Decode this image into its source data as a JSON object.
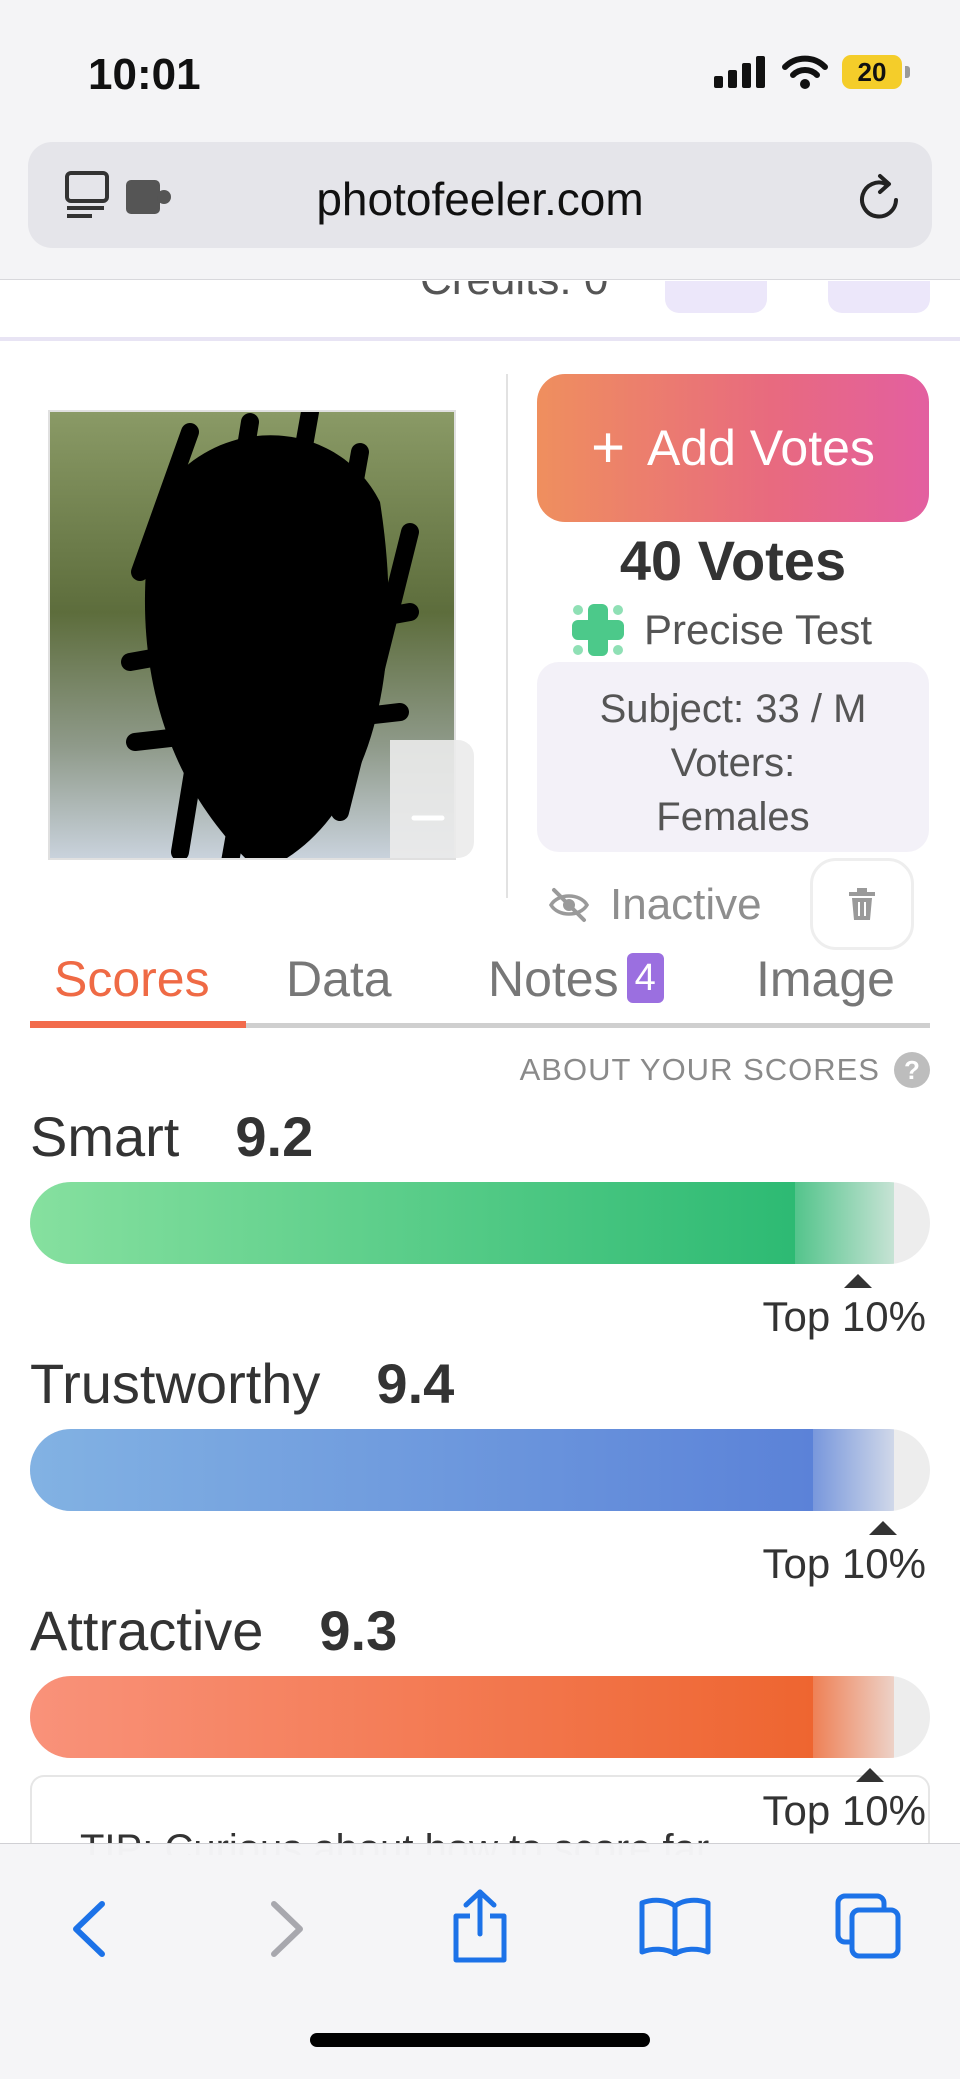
{
  "status_bar": {
    "time": "10:01",
    "battery": "20"
  },
  "browser": {
    "url": "photofeeler.com"
  },
  "header_peek": {
    "credits_text": "Credits: 0"
  },
  "photo": {
    "toggle_icon": "minus-icon"
  },
  "actions": {
    "add_votes_label": "Add Votes",
    "votes_count": "40 Votes",
    "test_type": "Precise Test"
  },
  "subject": {
    "line1": "Subject: 33 / M",
    "line2": "Voters:",
    "line3": "Females"
  },
  "status": {
    "inactive_label": "Inactive"
  },
  "tabs": [
    {
      "label": "Scores",
      "active": true
    },
    {
      "label": "Data",
      "active": false
    },
    {
      "label": "Notes",
      "badge": "4",
      "active": false
    },
    {
      "label": "Image",
      "active": false
    }
  ],
  "about_scores": "ABOUT YOUR SCORES",
  "scores": [
    {
      "label": "Smart",
      "value": "9.2",
      "percentile": "Top 10%",
      "fill_fraction": 0.85,
      "color_start": "#86e09f",
      "color_end": "#2dba73"
    },
    {
      "label": "Trustworthy",
      "value": "9.4",
      "percentile": "Top 10%",
      "fill_fraction": 0.87,
      "color_start": "#82b2e3",
      "color_end": "#5b82d8"
    },
    {
      "label": "Attractive",
      "value": "9.3",
      "percentile": "Top 10%",
      "fill_fraction": 0.87,
      "color_start": "#f9927a",
      "color_end": "#ee6530"
    }
  ],
  "tip": {
    "text": "TIP: Curious about how to score far..."
  },
  "colors": {
    "accent": "#f26b4c",
    "badge": "#9b6fe0",
    "ios_blue": "#1c72e8"
  }
}
